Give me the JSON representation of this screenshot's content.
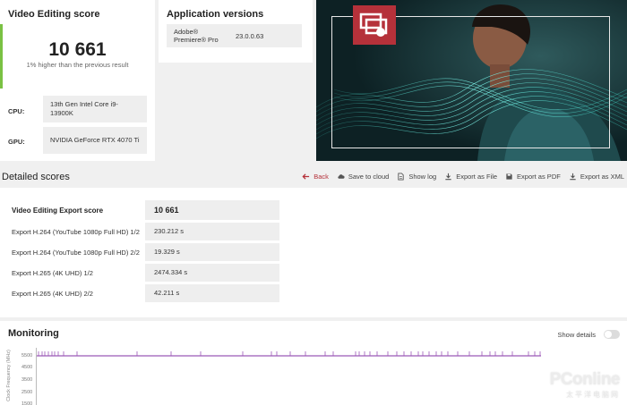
{
  "score_card": {
    "title": "Video Editing score",
    "score": "10 661",
    "comparison": "1% higher than the previous result",
    "cpu_label": "CPU:",
    "cpu_value": "13th Gen Intel Core i9-13900K",
    "gpu_label": "GPU:",
    "gpu_value": "NVIDIA GeForce RTX 4070 Ti",
    "accent_color": "#7ac143"
  },
  "app_versions": {
    "title": "Application versions",
    "app_name": "Adobe® Premiere® Pro",
    "app_version": "23.0.0.63"
  },
  "hero": {
    "logo_icon": "presentation-play-icon",
    "brand_color": "#b5313a"
  },
  "detailed": {
    "title": "Detailed scores",
    "toolbar": {
      "back": "Back",
      "save_to_cloud": "Save to cloud",
      "show_log": "Show log",
      "export_file": "Export as File",
      "export_pdf": "Export as PDF",
      "export_xml": "Export as XML"
    },
    "rows": [
      {
        "label": "Video Editing Export score",
        "value": "10 661"
      },
      {
        "label": "Export H.264 (YouTube 1080p Full HD) 1/2",
        "value": "230.212 s"
      },
      {
        "label": "Export H.264 (YouTube 1080p Full HD) 2/2",
        "value": "19.329 s"
      },
      {
        "label": "Export H.265 (4K UHD) 1/2",
        "value": "2474.334 s"
      },
      {
        "label": "Export H.265 (4K UHD) 2/2",
        "value": "42.211 s"
      }
    ]
  },
  "monitoring": {
    "title": "Monitoring",
    "show_details": "Show details",
    "axis_label": "Clock Frequency (MHz)",
    "ticks": [
      "5500",
      "4500",
      "3500",
      "2500",
      "1500"
    ],
    "line_color": "#9b59b6"
  },
  "watermark": {
    "main": "PConline",
    "sub": "太平洋电脑网"
  }
}
